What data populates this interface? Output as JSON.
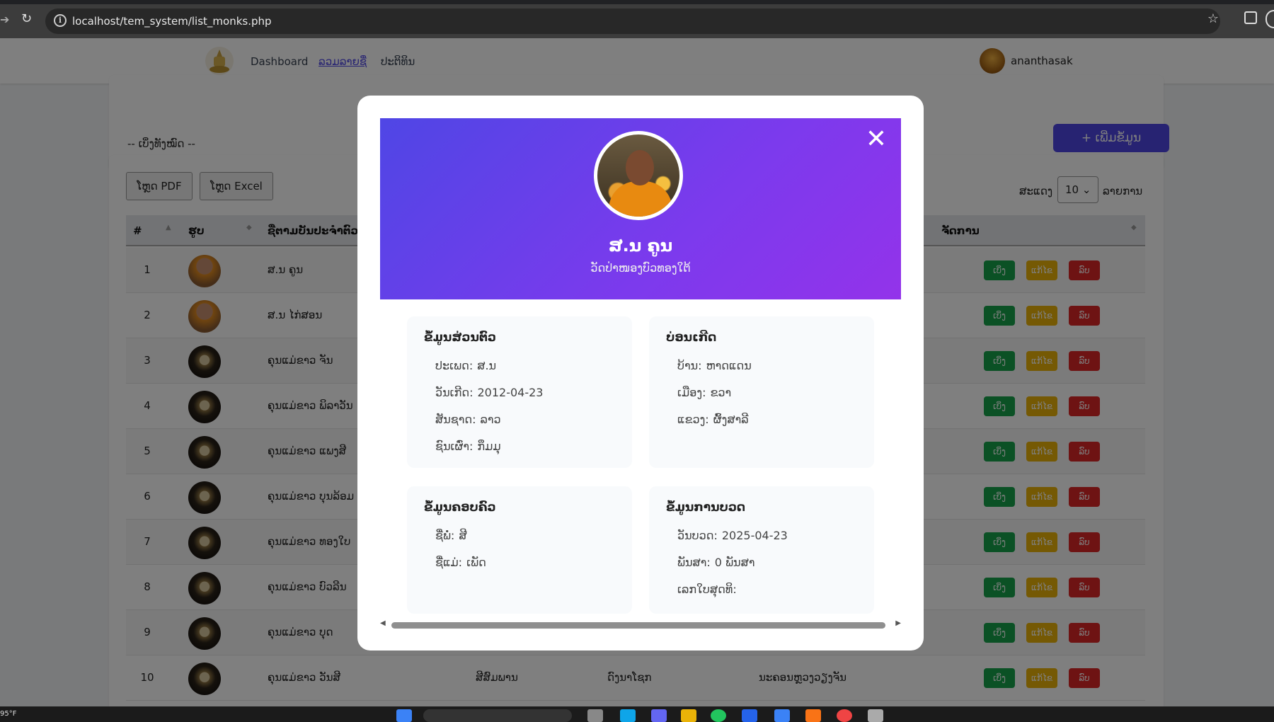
{
  "browser": {
    "url": "localhost/tem_system/list_monks.php"
  },
  "nav": {
    "links": [
      "Dashboard",
      "ລວມລາຍຊື່",
      "ປະຕິທິນ"
    ],
    "user": "ananthasak"
  },
  "filter": {
    "select_value": "-- ເບິ່ງທັງໝົດ --",
    "add_button": "+ ເພີ່ມຂໍ້ມູນ"
  },
  "table": {
    "export_pdf": "ໂຫຼດ PDF",
    "export_excel": "ໂຫຼດ Excel",
    "length_label_before": "ສະແດງ",
    "length_value": "10",
    "length_label_after": "ລາຍການ",
    "headers": [
      "#",
      "ຮູບ",
      "ຊື່ຕາມບັນປະຈຳຕົວ",
      "ຈັດການ"
    ],
    "actions": {
      "view": "ເບິ່ງ",
      "edit": "ແກ້ໄຂ",
      "delete": "ລົບ"
    },
    "rows": [
      {
        "num": "1",
        "name": "ສ.ນ ຄູນ",
        "img": "monk"
      },
      {
        "num": "2",
        "name": "ສ.ນ ໄກ່ສອນ",
        "img": "monk"
      },
      {
        "num": "3",
        "name": "ຄຸນແມ່ຂາວ ຈັນ",
        "img": "logo"
      },
      {
        "num": "4",
        "name": "ຄຸນແມ່ຂາວ ພິລາວັນ",
        "img": "logo"
      },
      {
        "num": "5",
        "name": "ຄຸນແມ່ຂາວ ແພງສີ",
        "img": "logo"
      },
      {
        "num": "6",
        "name": "ຄຸນແມ່ຂາວ ບຸນລ້ອມ",
        "img": "logo"
      },
      {
        "num": "7",
        "name": "ຄຸນແມ່ຂາວ ທອງໃບ",
        "img": "logo"
      },
      {
        "num": "8",
        "name": "ຄຸນແມ່ຂາວ ບົວລີນ",
        "img": "logo"
      },
      {
        "num": "9",
        "name": "ຄຸນແມ່ຂາວ ບຸດ",
        "img": "logo"
      },
      {
        "num": "10",
        "name": "ຄຸນແມ່ຂາວ ວັນສີ",
        "img": "logo",
        "c4": "ສີສົມພານ",
        "c5": "ດົງນາໂຊກ",
        "c6": "ນະຄອນຫຼວງວຽງຈັນ"
      }
    ]
  },
  "modal": {
    "name": "ສ.ນ ຄູນ",
    "temple": "ວັດປ່າໜອງບົວທອງໃຕ້",
    "personal": {
      "title": "ຂໍ້ມູນສ່ວນຕົວ",
      "rows": [
        {
          "k": "ປະເພດ:",
          "v": "ສ.ນ"
        },
        {
          "k": "ວັນເກີດ:",
          "v": "2012-04-23"
        },
        {
          "k": "ສັນຊາດ:",
          "v": "ລາວ"
        },
        {
          "k": "ຊົນເຜົ່າ:",
          "v": "ກຶມມຸ"
        }
      ]
    },
    "birthplace": {
      "title": "ບ່ອນເກີດ",
      "rows": [
        {
          "k": "ບ້ານ:",
          "v": "ຫາດແດນ"
        },
        {
          "k": "ເມືອງ:",
          "v": "ຂວາ"
        },
        {
          "k": "ແຂວງ:",
          "v": "ຜົ້ງສາລີ"
        }
      ]
    },
    "family": {
      "title": "ຂໍ້ມູນຄອບຄົວ",
      "rows": [
        {
          "k": "ຊື່ພໍ່:",
          "v": "ສີ"
        },
        {
          "k": "ຊື່ແມ່:",
          "v": "ເພັດ"
        }
      ]
    },
    "ordination": {
      "title": "ຂໍ້ມູນການບວດ",
      "rows": [
        {
          "k": "ວັນບວດ:",
          "v": "2025-04-23"
        },
        {
          "k": "ພັນສາ:",
          "v": "0 ພັນສາ"
        },
        {
          "k": "ເລກໃບສຸດທິ:",
          "v": ""
        }
      ]
    }
  },
  "taskbar": {
    "temp": "95°F"
  },
  "colors": {
    "primary": "#4f46e5",
    "gradient_end": "#9333ea",
    "view": "#16a34a",
    "edit": "#eab308",
    "delete": "#dc2626"
  }
}
